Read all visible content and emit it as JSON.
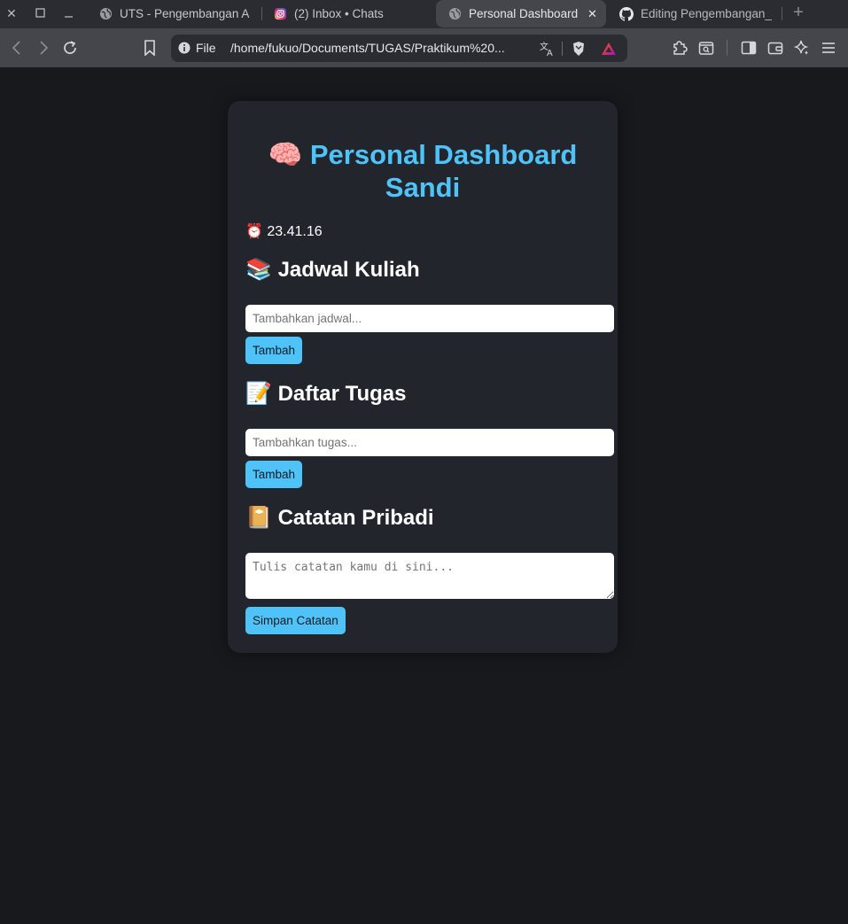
{
  "browser": {
    "tabs": [
      {
        "title": "UTS - Pengembangan A",
        "icon": "globe-icon",
        "active": false
      },
      {
        "title": "(2) Inbox • Chats",
        "icon": "instagram-icon",
        "active": false
      },
      {
        "title": "Personal Dashboard",
        "icon": "globe-icon",
        "active": true
      },
      {
        "title": "Editing Pengembangan_",
        "icon": "github-icon",
        "active": false
      }
    ],
    "url_scheme": "File",
    "url": "/home/fukuo/Documents/TUGAS/Praktikum%20..."
  },
  "page": {
    "title_emoji": "🧠",
    "title": "Personal Dashboard Sandi",
    "clock_emoji": "⏰",
    "clock": "23.41.16",
    "schedule": {
      "emoji": "📚",
      "heading": "Jadwal Kuliah",
      "placeholder": "Tambahkan jadwal...",
      "button": "Tambah"
    },
    "tasks": {
      "emoji": "📝",
      "heading": "Daftar Tugas",
      "placeholder": "Tambahkan tugas...",
      "button": "Tambah"
    },
    "notes": {
      "emoji": "📔",
      "heading": "Catatan Pribadi",
      "placeholder": "Tulis catatan kamu di sini...",
      "button": "Simpan Catatan"
    }
  },
  "colors": {
    "background": "#18191d",
    "card": "#23252d",
    "accent": "#4fc3f7"
  }
}
